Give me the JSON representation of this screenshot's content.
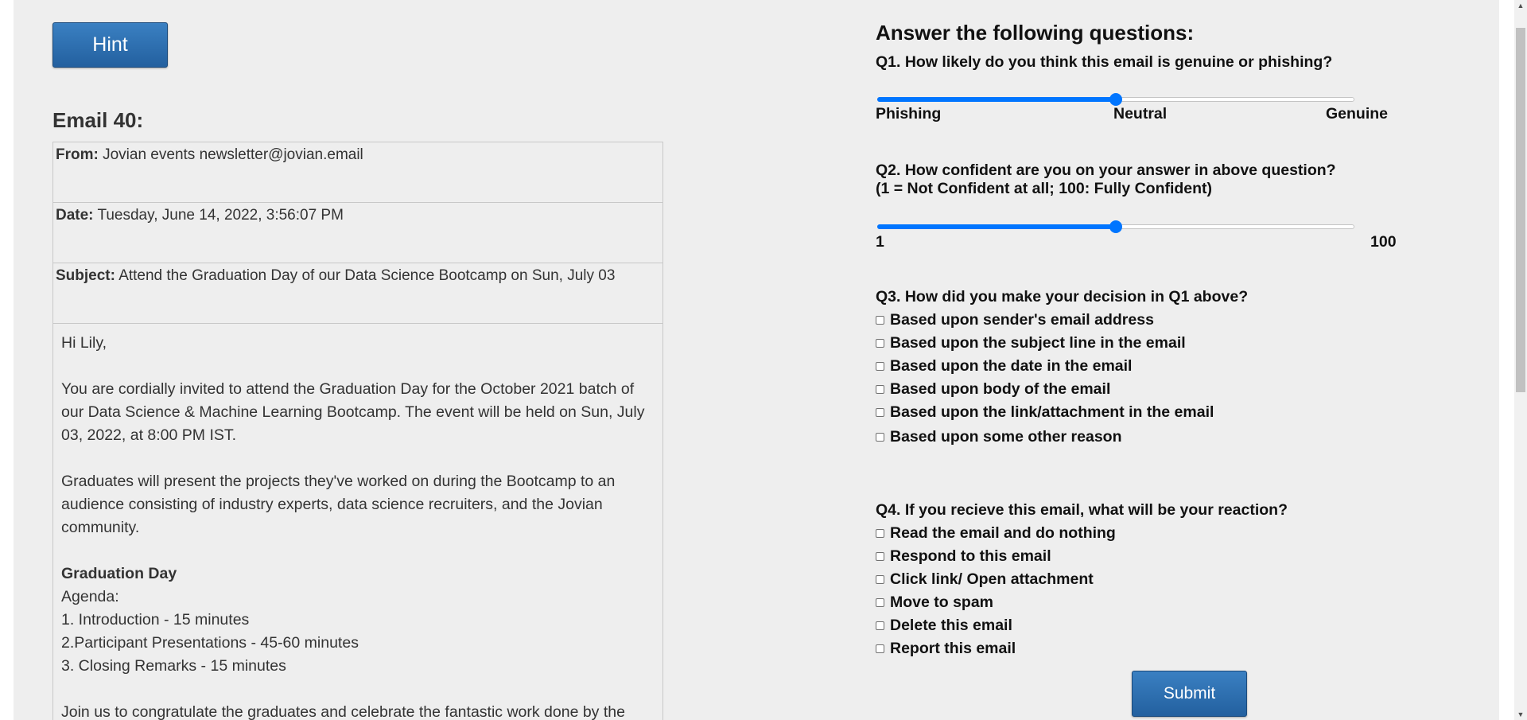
{
  "hint_button": "Hint",
  "email": {
    "title": "Email 40:",
    "from_label": "From:",
    "from_value": "Jovian events newsletter@jovian.email",
    "date_label": "Date:",
    "date_value": "Tuesday, June 14, 2022, 3:56:07 PM",
    "subject_label": "Subject:",
    "subject_value": "Attend the Graduation Day of our Data Science Bootcamp on Sun, July 03",
    "greeting": "Hi Lily,",
    "para1": "You are cordially invited to attend the Graduation Day for the October 2021 batch of our Data Science & Machine Learning Bootcamp. The event will be held on Sun, July 03, 2022, at 8:00 PM IST.",
    "para2": "Graduates will present the projects they've worked on during the Bootcamp to an audience consisting of industry experts, data science recruiters, and the Jovian community.",
    "section_heading": "Graduation Day",
    "agenda_label": "Agenda:",
    "agenda": [
      "1. Introduction - 15 minutes",
      "2.Participant Presentations - 45-60 minutes",
      "3. Closing Remarks - 15 minutes"
    ],
    "closing": "Join us to congratulate the graduates and celebrate the fantastic work done by the"
  },
  "questions": {
    "title": "Answer the following questions:",
    "q1": {
      "text": "Q1. How likely do you think this email is genuine or phishing?",
      "left_label": "Phishing",
      "mid_label": "Neutral",
      "right_label": "Genuine",
      "value_fraction": 0.5
    },
    "q2": {
      "text_line1": "Q2. How confident are you on your answer in above question?",
      "text_line2": "(1 = Not Confident at all; 100: Fully Confident)",
      "min_label": "1",
      "max_label": "100",
      "value_fraction": 0.5
    },
    "q3": {
      "text": "Q3. How did you make your decision in Q1 above?",
      "options": [
        "Based upon sender's email address",
        "Based upon the subject line in the email",
        "Based upon the date in the email",
        "Based upon body of the email",
        "Based upon the link/attachment in the email",
        "Based upon some other reason"
      ]
    },
    "q4": {
      "text": "Q4. If you recieve this email, what will be your reaction?",
      "options": [
        "Read the email and do nothing",
        "Respond to this email",
        "Click link/ Open attachment",
        "Move to spam",
        "Delete this email",
        "Report this email"
      ]
    }
  },
  "submit_button": "Submit"
}
